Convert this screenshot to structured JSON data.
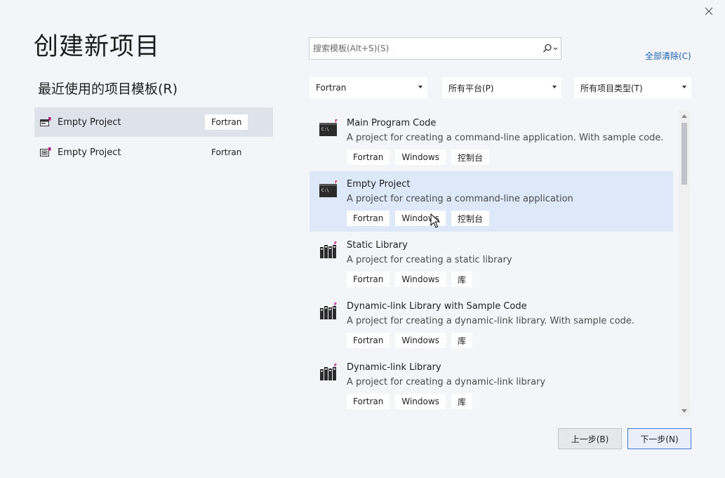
{
  "title": "创建新项目",
  "close_icon": "close-icon",
  "recent": {
    "heading": "最近使用的项目模板(R)",
    "items": [
      {
        "label": "Empty Project",
        "tag": "Fortran",
        "icon": "console-project-icon",
        "selected": true
      },
      {
        "label": "Empty Project",
        "tag": "Fortran",
        "icon": "project-template-icon",
        "selected": false
      }
    ]
  },
  "search": {
    "placeholder": "搜索模板(Alt+S)(S)",
    "value": "",
    "icon": "search-icon"
  },
  "clear_all": "全部清除(C)",
  "filters": {
    "language": "Fortran",
    "platform": "所有平台(P)",
    "project_type": "所有项目类型(T)"
  },
  "templates": [
    {
      "name": "Main Program Code",
      "description": "A project for creating a command-line application. With sample code.",
      "tags": [
        "Fortran",
        "Windows",
        "控制台"
      ],
      "icon": "console-app-icon",
      "selected": false
    },
    {
      "name": "Empty Project",
      "description": "A project for creating a command-line application",
      "tags": [
        "Fortran",
        "Windows",
        "控制台"
      ],
      "icon": "console-app-icon",
      "selected": true
    },
    {
      "name": "Static Library",
      "description": "A project for creating a static library",
      "tags": [
        "Fortran",
        "Windows",
        "库"
      ],
      "icon": "library-icon",
      "selected": false
    },
    {
      "name": "Dynamic-link Library with Sample Code",
      "description": "A project for creating a dynamic-link library. With sample code.",
      "tags": [
        "Fortran",
        "Windows",
        "库"
      ],
      "icon": "library-icon",
      "selected": false
    },
    {
      "name": "Dynamic-link Library",
      "description": "A project for creating a dynamic-link library",
      "tags": [
        "Fortran",
        "Windows",
        "库"
      ],
      "icon": "library-icon",
      "selected": false
    }
  ],
  "buttons": {
    "back": "上一步(B)",
    "next": "下一步(N)"
  },
  "colors": {
    "accent": "#3f7bd6",
    "link": "#1a5fb4",
    "fortran_badge": "#b0197a",
    "selected_row": "#dde8f8",
    "background": "#f4f5f8"
  }
}
